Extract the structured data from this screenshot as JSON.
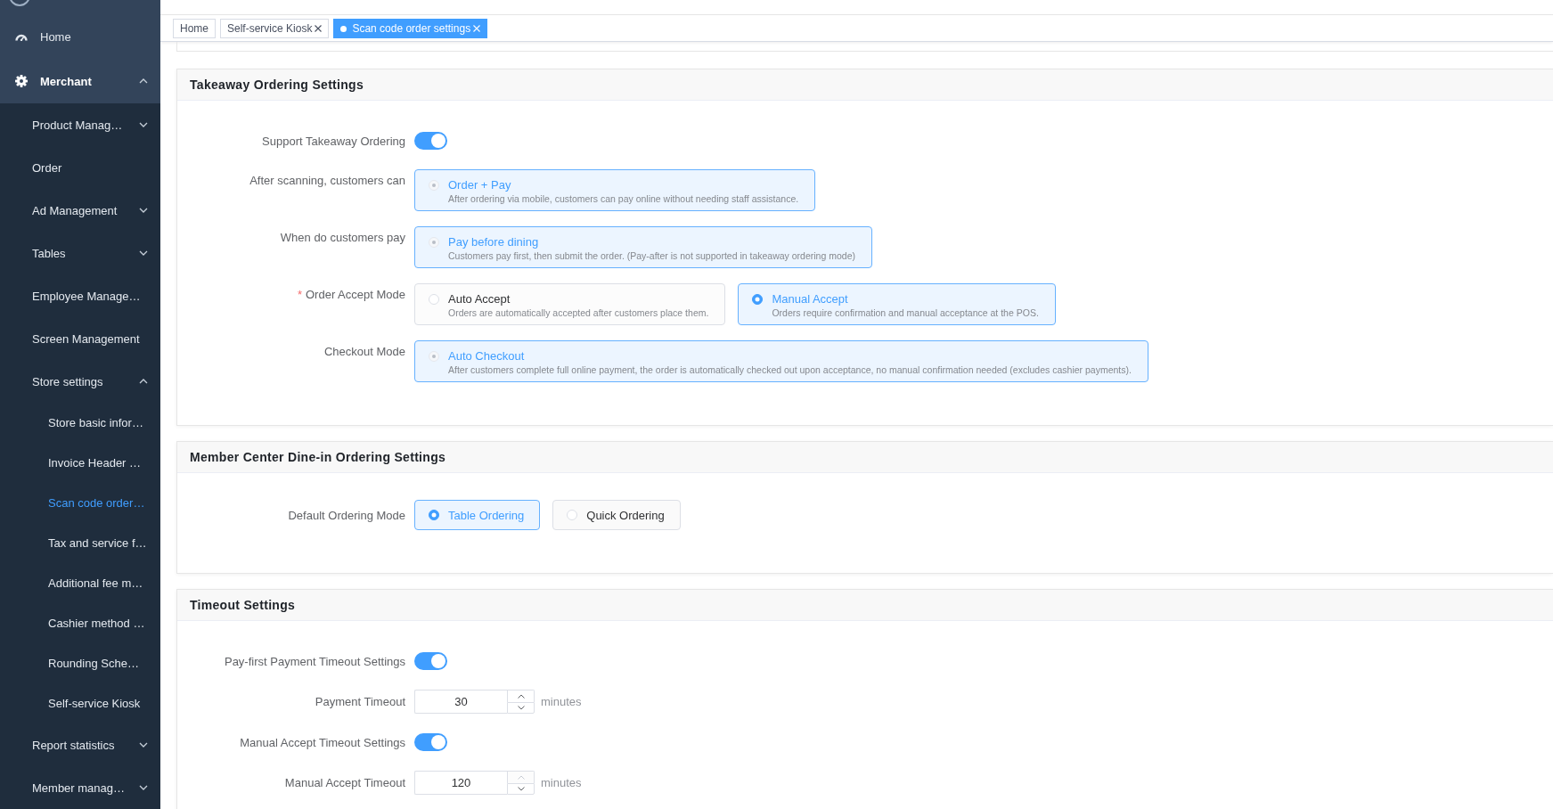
{
  "sidebar": {
    "items": [
      {
        "label": "Home",
        "selected": false
      },
      {
        "label": "Merchant",
        "selected": false,
        "expanded": true,
        "children": [
          {
            "label": "Product Manag…",
            "selected": false,
            "expanded": false
          },
          {
            "label": "Order",
            "selected": false
          },
          {
            "label": "Ad Management",
            "selected": false,
            "expanded": false
          },
          {
            "label": "Tables",
            "selected": false,
            "expanded": false
          },
          {
            "label": "Employee Manage…",
            "selected": false
          },
          {
            "label": "Screen Management",
            "selected": false
          },
          {
            "label": "Store settings",
            "selected": false,
            "expanded": true,
            "children": [
              {
                "label": "Store basic infor…",
                "selected": false
              },
              {
                "label": "Invoice Header …",
                "selected": false
              },
              {
                "label": "Scan code order…",
                "selected": true
              },
              {
                "label": "Tax and service f…",
                "selected": false
              },
              {
                "label": "Additional fee m…",
                "selected": false
              },
              {
                "label": "Cashier method …",
                "selected": false
              },
              {
                "label": "Rounding Sche…",
                "selected": false
              },
              {
                "label": "Self-service Kiosk",
                "selected": false
              }
            ]
          },
          {
            "label": "Report statistics",
            "selected": false,
            "expanded": false
          },
          {
            "label": "Member manag…",
            "selected": false,
            "expanded": false
          }
        ]
      }
    ]
  },
  "tabs": [
    {
      "label": "Home",
      "selected": false,
      "closable": false
    },
    {
      "label": "Self-service Kiosk",
      "selected": false,
      "closable": true
    },
    {
      "label": "Scan code order settings",
      "selected": true,
      "closable": true
    }
  ],
  "sections": [
    {
      "title": "Takeaway Ordering Settings",
      "rows": [
        {
          "kind": "switch",
          "label": "Support Takeaway Ordering",
          "on": true
        },
        {
          "kind": "options",
          "label": "After scanning, customers can",
          "options": [
            {
              "title": "Order + Pay",
              "description": "After ordering via mobile, customers can pay online without needing staff assistance.",
              "selected": true,
              "disabled": true
            }
          ]
        },
        {
          "kind": "options",
          "label": "When do customers pay",
          "options": [
            {
              "title": "Pay before dining",
              "description": "Customers pay first, then submit the order. (Pay-after is not supported in takeaway ordering mode)",
              "selected": true,
              "disabled": true
            }
          ]
        },
        {
          "kind": "options",
          "label": "Order Accept Mode",
          "required_mark": "*",
          "options": [
            {
              "title": "Auto Accept",
              "description": "Orders are automatically accepted after customers place them.",
              "selected": false,
              "disabled": false
            },
            {
              "title": "Manual Accept",
              "description": "Orders require confirmation and manual acceptance at the POS.",
              "selected": true,
              "disabled": false
            }
          ]
        },
        {
          "kind": "options",
          "label": "Checkout Mode",
          "options": [
            {
              "title": "Auto Checkout",
              "description": "After customers complete full online payment, the order is automatically checked out upon acceptance, no manual confirmation needed (excludes cashier payments).",
              "selected": true,
              "disabled": true
            }
          ]
        }
      ]
    },
    {
      "title": "Member Center Dine-in Ordering Settings",
      "rows": [
        {
          "kind": "choice",
          "label": "Default Ordering Mode",
          "options": [
            {
              "label": "Table Ordering",
              "selected": true
            },
            {
              "label": "Quick Ordering",
              "selected": false
            }
          ]
        }
      ]
    },
    {
      "title": "Timeout Settings",
      "rows": [
        {
          "kind": "switch",
          "label": "Pay-first Payment Timeout Settings",
          "on": true
        },
        {
          "kind": "number",
          "label": "Payment Timeout",
          "value": "30",
          "unit": "minutes",
          "increase_disabled": false
        },
        {
          "kind": "switch",
          "label": "Manual Accept Timeout Settings",
          "on": true
        },
        {
          "kind": "number",
          "label": "Manual Accept Timeout",
          "value": "120",
          "unit": "minutes",
          "increase_disabled": true
        }
      ]
    }
  ]
}
